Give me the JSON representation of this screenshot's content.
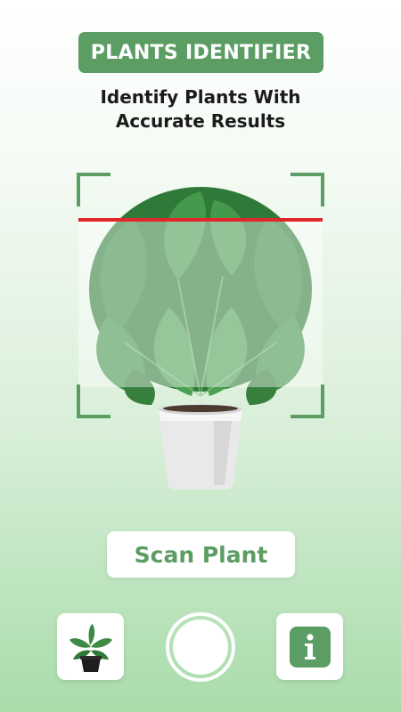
{
  "header": {
    "title": "PLANTS IDENTIFIER",
    "subtitle_line1": "Identify Plants With",
    "subtitle_line2": "Accurate Results"
  },
  "scanner": {
    "frame_color": "#5c9d63",
    "scan_line_color": "#e0262b",
    "subject_icon": "monstera-plant-image"
  },
  "actions": {
    "scan_label": "Scan Plant",
    "gallery_icon": "potted-plant-thumbnail",
    "shutter_icon": "camera-shutter",
    "info_icon": "info-icon"
  },
  "colors": {
    "accent": "#5c9d63",
    "background_bottom": "#a9dcab"
  }
}
